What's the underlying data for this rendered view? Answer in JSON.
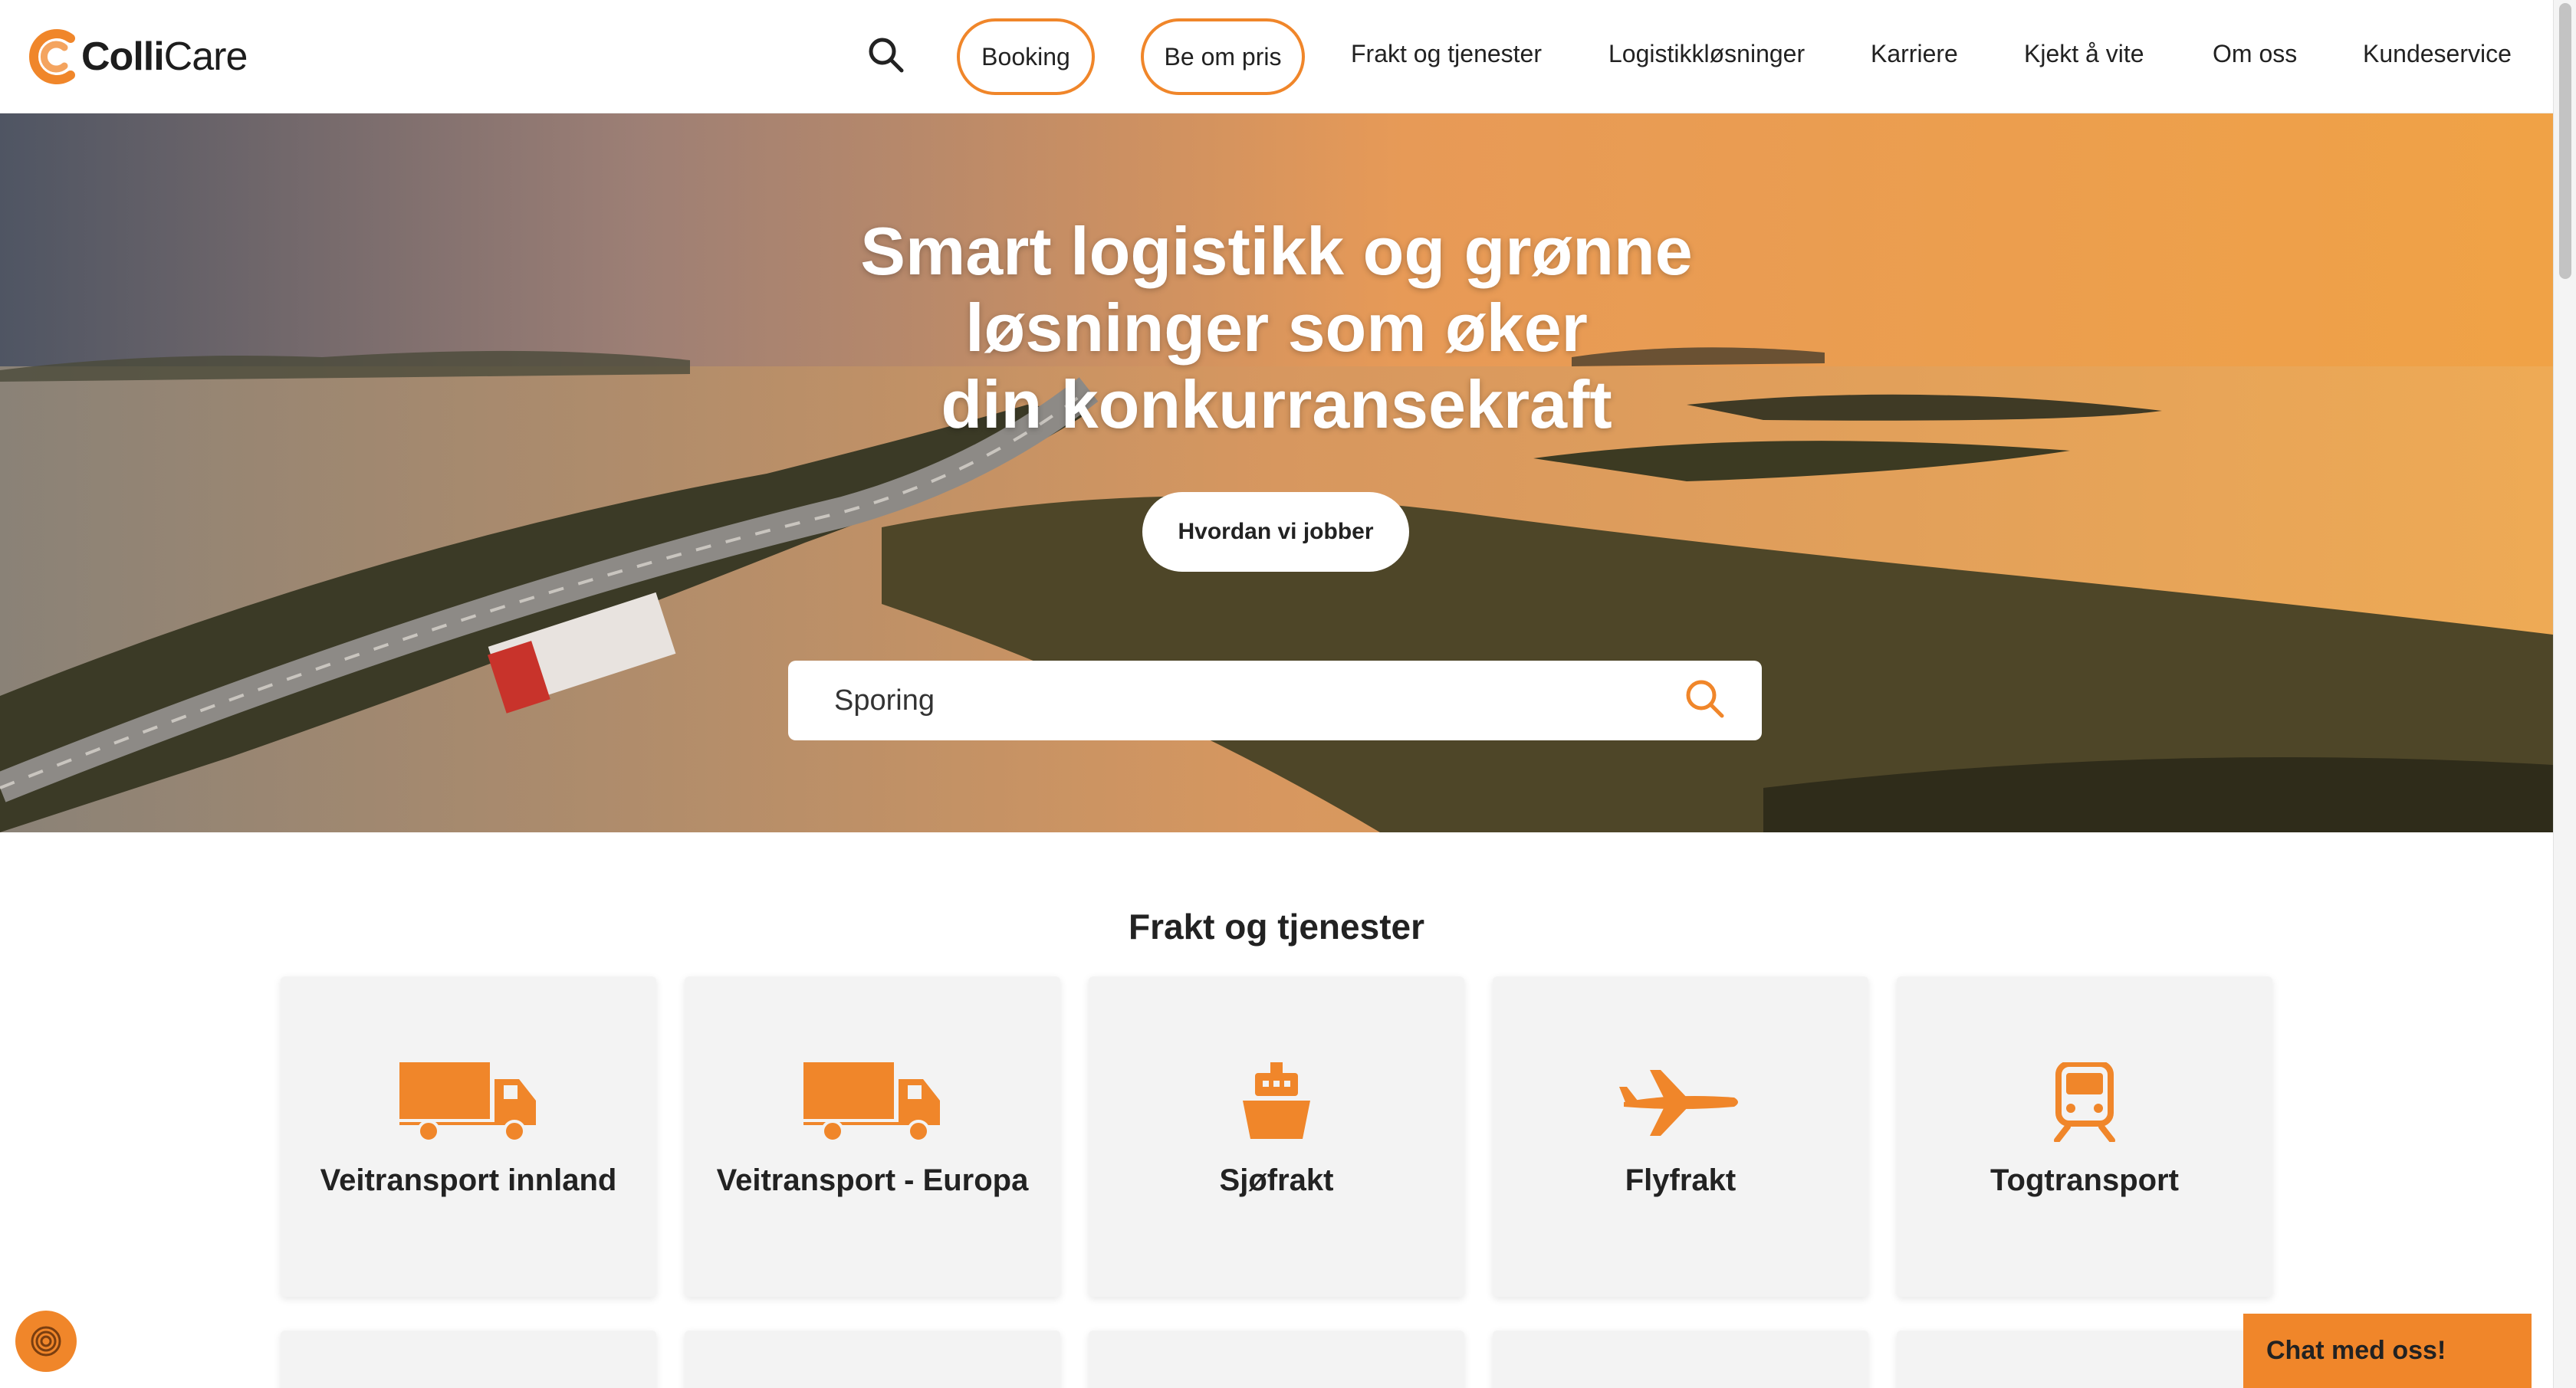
{
  "brand": {
    "logo_bold": "Colli",
    "logo_regular": "Care",
    "accent": "#f0862a"
  },
  "nav": {
    "booking": "Booking",
    "pris": "Be om pris",
    "links": [
      "Frakt og tjenester",
      "Logistikkløsninger",
      "Karriere",
      "Kjekt å vite",
      "Om oss",
      "Kundeservice"
    ]
  },
  "hero": {
    "title_lines": [
      "Smart logistikk og grønne",
      "løsninger som øker",
      "din konkurransekraft"
    ],
    "cta": "Hvordan vi jobber",
    "tracking_placeholder": "Sporing"
  },
  "services": {
    "title": "Frakt og tjenester",
    "cards": [
      {
        "label": "Veitransport innland",
        "icon": "truck-icon"
      },
      {
        "label": "Veitransport - Europa",
        "icon": "truck-icon"
      },
      {
        "label": "Sjøfrakt",
        "icon": "ship-icon"
      },
      {
        "label": "Flyfrakt",
        "icon": "plane-icon"
      },
      {
        "label": "Togtransport",
        "icon": "train-icon"
      }
    ]
  },
  "chat": {
    "label": "Chat med oss!"
  }
}
